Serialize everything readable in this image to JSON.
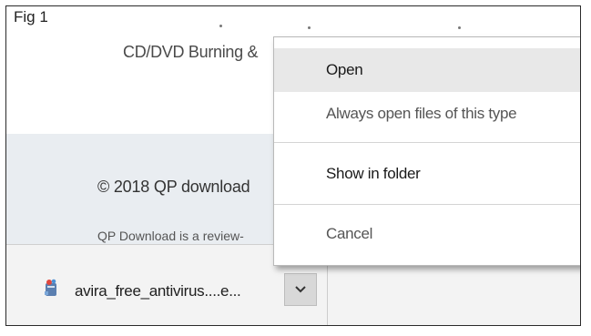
{
  "figure": {
    "label": "Fig 1"
  },
  "page": {
    "heading": "CD/DVD Burning &",
    "copyright": "© 2018 QP download",
    "description": "QP Download is a review-"
  },
  "download": {
    "file_name": "avira_free_antivirus....e...",
    "file_icon": "installer-icon",
    "menu_button_icon": "chevron-down-icon"
  },
  "context_menu": {
    "items": [
      {
        "label": "Open"
      },
      {
        "label": "Always open files of this type"
      },
      {
        "label": "Show in folder"
      },
      {
        "label": "Cancel"
      }
    ]
  },
  "colors": {
    "menu_highlight": "#e8e8e8",
    "download_bar": "#f3f3f3",
    "footer_background": "#e9edf1"
  }
}
